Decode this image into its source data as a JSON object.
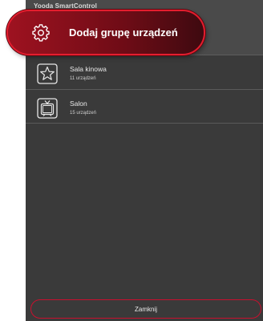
{
  "app": {
    "title": "Yooda SmartControl"
  },
  "highlight": {
    "label": "Dodaj grupę urządzeń",
    "icon": "gear-icon"
  },
  "groups": [
    {
      "title": "Sala kinowa",
      "subtitle": "11 urządzeń",
      "icon": "star-icon"
    },
    {
      "title": "Salon",
      "subtitle": "15 urządzeń",
      "icon": "tv-icon"
    }
  ],
  "footer": {
    "close_label": "Zamknij"
  },
  "colors": {
    "accent": "#e41d2e",
    "panel": "#3a3a3a",
    "topbar": "#4a4a4a"
  }
}
